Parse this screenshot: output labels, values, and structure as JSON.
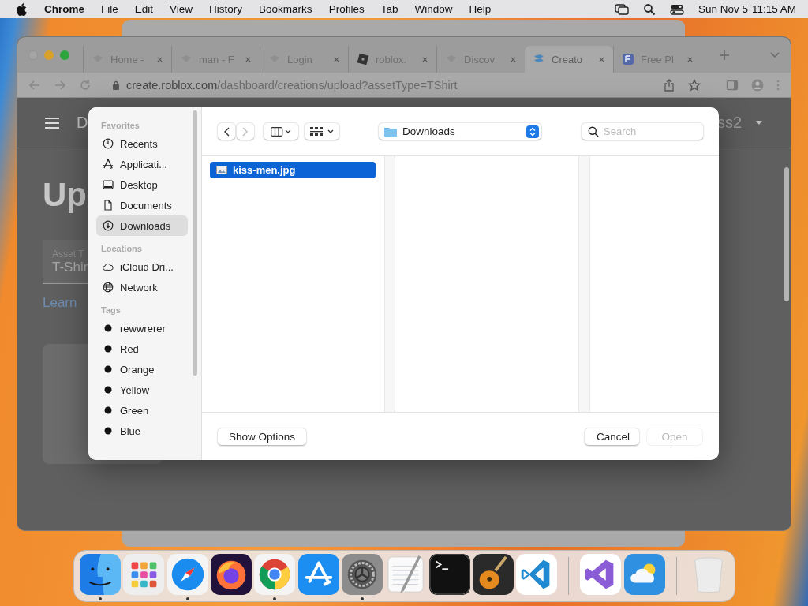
{
  "menu_bar": {
    "app": "Chrome",
    "items": [
      "File",
      "Edit",
      "View",
      "History",
      "Bookmarks",
      "Profiles",
      "Tab",
      "Window",
      "Help"
    ],
    "date": "Sun Nov 5",
    "time": "11:15 AM"
  },
  "browser": {
    "tabs": [
      {
        "title": "Home -",
        "kind": "page",
        "selected": false
      },
      {
        "title": "man - F",
        "kind": "page",
        "selected": false
      },
      {
        "title": "Login",
        "kind": "page",
        "selected": false
      },
      {
        "title": "roblox.",
        "kind": "roblox",
        "selected": false
      },
      {
        "title": "Discov",
        "kind": "page",
        "selected": false
      },
      {
        "title": "Creato",
        "kind": "creator",
        "selected": true
      },
      {
        "title": "Free Pl",
        "kind": "free",
        "selected": false
      }
    ],
    "url_host": "create.roblox.com",
    "url_path": "/dashboard/creations/upload?assetType=TShirt",
    "page": {
      "header_title": "D",
      "account": "ss2",
      "heading": "Up",
      "field_label": "Asset T",
      "field_value": "T-Shir",
      "link": "Learn"
    }
  },
  "dialog": {
    "sidebar": [
      {
        "heading": "Favorites",
        "items": [
          {
            "label": "Recents",
            "kind": "clock",
            "selected": false
          },
          {
            "label": "Applicati...",
            "kind": "apps",
            "selected": false
          },
          {
            "label": "Desktop",
            "kind": "desktop",
            "selected": false
          },
          {
            "label": "Documents",
            "kind": "document",
            "selected": false
          },
          {
            "label": "Downloads",
            "kind": "download",
            "selected": true
          }
        ]
      },
      {
        "heading": "Locations",
        "items": [
          {
            "label": "iCloud Dri...",
            "kind": "cloud",
            "selected": false
          },
          {
            "label": "Network",
            "kind": "globe",
            "selected": false
          }
        ]
      },
      {
        "heading": "Tags",
        "items": [
          {
            "label": "rewwrerer",
            "kind": "tag",
            "selected": false
          },
          {
            "label": "Red",
            "kind": "tag",
            "selected": false
          },
          {
            "label": "Orange",
            "kind": "tag",
            "selected": false
          },
          {
            "label": "Yellow",
            "kind": "tag",
            "selected": false
          },
          {
            "label": "Green",
            "kind": "tag",
            "selected": false
          },
          {
            "label": "Blue",
            "kind": "tag",
            "selected": false
          }
        ]
      }
    ],
    "location": "Downloads",
    "search": {
      "placeholder": "Search"
    },
    "files": [
      {
        "name": "kiss-men.jpg",
        "selected": true
      }
    ],
    "buttons": [
      {
        "label": "Show Options",
        "disabled": false
      },
      {
        "label": "Cancel",
        "disabled": false
      },
      {
        "label": "Open",
        "disabled": true
      }
    ]
  },
  "dock": [
    {
      "kind": "finder",
      "running": true
    },
    {
      "kind": "launchpad",
      "running": false
    },
    {
      "kind": "safari",
      "running": true
    },
    {
      "kind": "firefox",
      "running": false
    },
    {
      "kind": "chrome",
      "running": true
    },
    {
      "kind": "appstore",
      "running": false
    },
    {
      "kind": "settings",
      "running": true
    },
    {
      "kind": "textedit",
      "running": false
    },
    {
      "kind": "terminal",
      "running": false
    },
    {
      "kind": "garageband",
      "running": false
    },
    {
      "kind": "vscode",
      "running": false
    },
    {
      "kind": "separator"
    },
    {
      "kind": "visualstudio",
      "running": false
    },
    {
      "kind": "weather",
      "running": false
    },
    {
      "kind": "separator"
    },
    {
      "kind": "trash",
      "running": false
    }
  ]
}
